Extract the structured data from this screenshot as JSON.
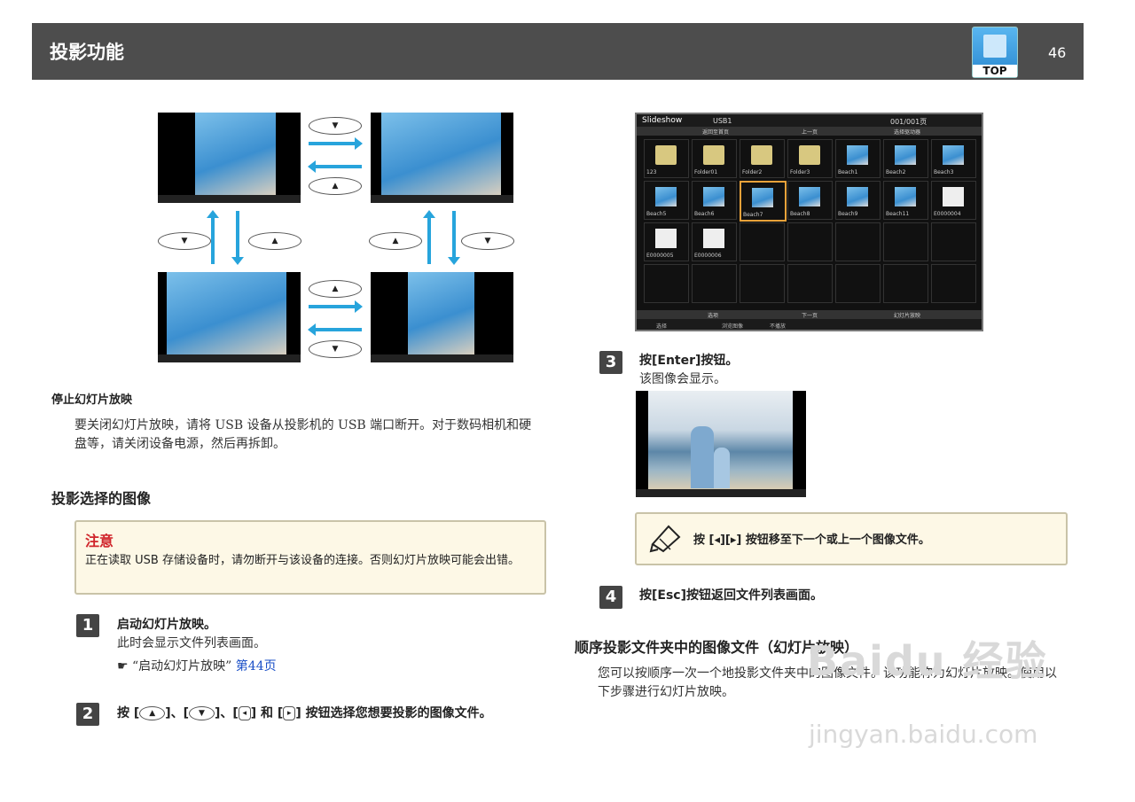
{
  "header": {
    "title": "投影功能",
    "top_label": "TOP",
    "page_number": "46"
  },
  "diagram": {
    "up_symbol": "▲",
    "down_symbol": "▼"
  },
  "stop_section": {
    "heading": "停止幻灯片放映",
    "body": "要关闭幻灯片放映，请将 USB 设备从投影机的 USB 端口断开。对于数码相机和硬盘等，请关闭设备电源，然后再拆卸。"
  },
  "select_section": {
    "heading": "投影选择的图像"
  },
  "caution": {
    "title": "注意",
    "body": "正在读取 USB 存储设备时，请勿断开与该设备的连接。否则幻灯片放映可能会出错。"
  },
  "steps": [
    {
      "number": "1",
      "title": "启动幻灯片放映。",
      "desc": "此时会显示文件列表画面。",
      "ref_symbol": "☛",
      "ref_text": "“启动幻灯片放映”",
      "ref_link": "第44页"
    },
    {
      "number": "2",
      "prefix": "按",
      "sep1": "、",
      "sep2": "、",
      "and": "和",
      "suffix": "按钮选择您想要投影的图像文件。"
    },
    {
      "number": "3",
      "title": "按[Enter]按钮。",
      "desc": "该图像会显示。"
    },
    {
      "number": "4",
      "title": "按[Esc]按钮返回文件列表画面。"
    }
  ],
  "slideshow_ui": {
    "title": "Slideshow",
    "device": "USB1",
    "page": "001/001页",
    "back": "返回至首页",
    "up": "上一页",
    "select_all": "选择驱动器",
    "down": "下一页",
    "options": "选项",
    "start": "幻灯片放映",
    "footer": [
      "选择",
      "浏览图像",
      "不播放"
    ],
    "items": [
      "123",
      "Folder01",
      "Folder2",
      "Folder3",
      "Beach1",
      "Beach2",
      "Beach3",
      "Beach5",
      "Beach6",
      "Beach7",
      "Beach8",
      "Beach9",
      "Beach11",
      "E0000004",
      "E0000005",
      "E0000006"
    ]
  },
  "tip": {
    "text": "按 [◂][▸] 按钮移至下一个或上一个图像文件。"
  },
  "sequence_section": {
    "heading": "顺序投影文件夹中的图像文件（幻灯片放映）",
    "body": "您可以按顺序一次一个地投影文件夹中的图像文件。该功能称为幻灯片放映。使用以下步骤进行幻灯片放映。"
  },
  "watermark": {
    "line1": "Baidu 经验",
    "line2": "jingyan.baidu.com"
  }
}
